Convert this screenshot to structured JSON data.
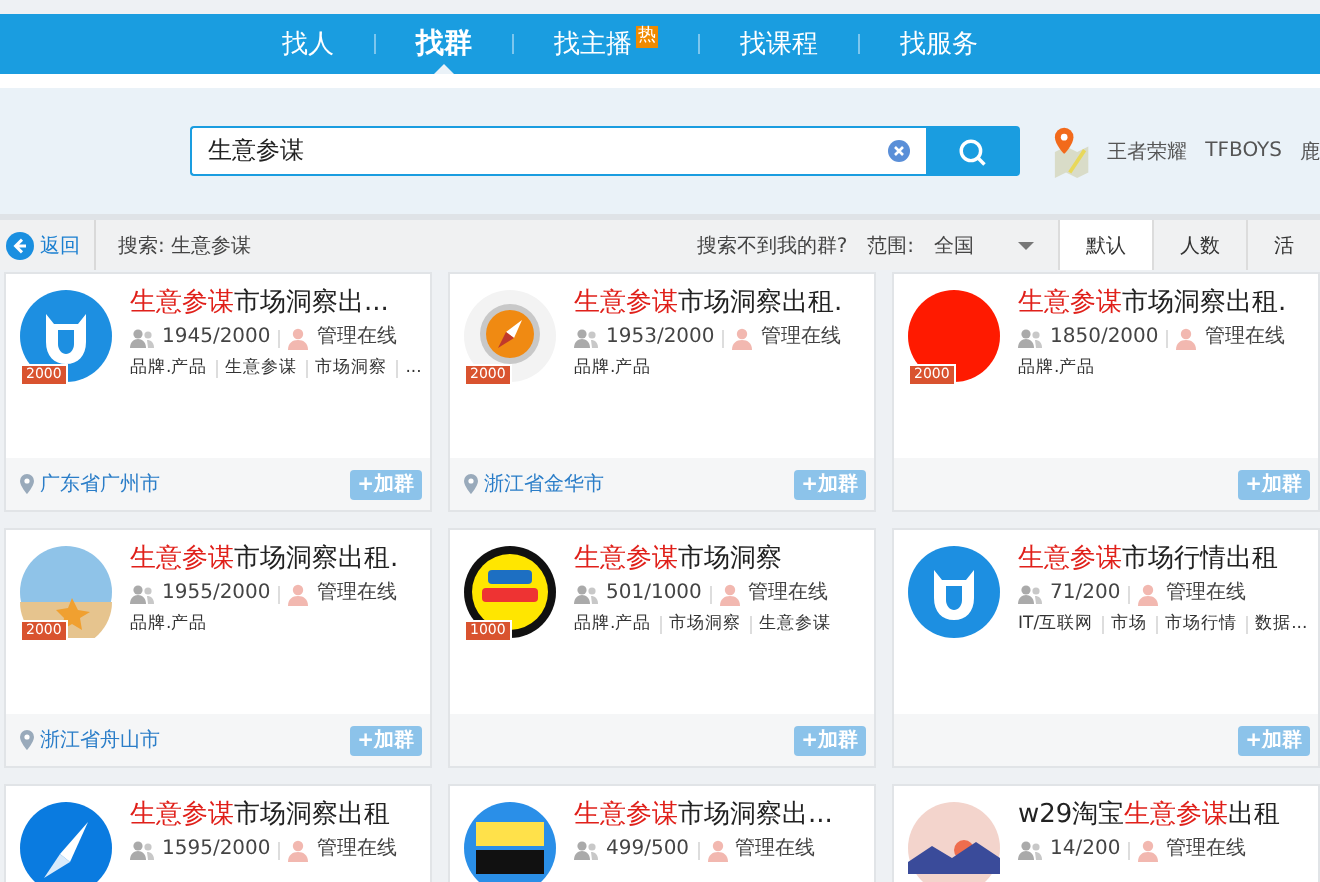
{
  "nav": {
    "tabs": [
      {
        "label": "找人",
        "selected": false
      },
      {
        "label": "找群",
        "selected": true
      },
      {
        "label": "找主播",
        "selected": false,
        "badge": "热"
      },
      {
        "label": "找课程",
        "selected": false
      },
      {
        "label": "找服务",
        "selected": false
      }
    ]
  },
  "search": {
    "value": "生意参谋",
    "hot_keywords": [
      "王者荣耀",
      "TFBOYS",
      "鹿"
    ]
  },
  "filter_bar": {
    "back": "返回",
    "query": "搜索: 生意参谋",
    "not_found_link": "搜索不到我的群?",
    "range_label": "范围:",
    "range_value": "全国",
    "sort_tabs": [
      {
        "label": "默认",
        "selected": true
      },
      {
        "label": "人数",
        "selected": false
      },
      {
        "label": "活",
        "selected": false
      }
    ]
  },
  "groups": [
    {
      "avatar": {
        "kind": "cow"
      },
      "level_badge": "2000",
      "title": [
        {
          "text": "生意参谋",
          "highlight": true
        },
        {
          "text": "市场洞察出...",
          "highlight": false
        }
      ],
      "members": "1945/2000",
      "admin_status": "管理在线",
      "tags": [
        "品牌.产品",
        "生意参谋",
        "市场洞察",
        "..."
      ],
      "location": "广东省广州市",
      "join_button": "+加群"
    },
    {
      "avatar": {
        "kind": "compass-orange"
      },
      "level_badge": "2000",
      "title": [
        {
          "text": "生意参谋",
          "highlight": true
        },
        {
          "text": "市场洞察出租.",
          "highlight": false
        }
      ],
      "members": "1953/2000",
      "admin_status": "管理在线",
      "tags": [
        "品牌.产品"
      ],
      "location": "浙江省金华市",
      "join_button": "+加群"
    },
    {
      "avatar": {
        "kind": "red"
      },
      "level_badge": "2000",
      "title": [
        {
          "text": "生意参谋",
          "highlight": true
        },
        {
          "text": "市场洞察出租.",
          "highlight": false
        }
      ],
      "members": "1850/2000",
      "admin_status": "管理在线",
      "tags": [
        "品牌.产品"
      ],
      "join_button": "+加群"
    },
    {
      "avatar": {
        "kind": "photo"
      },
      "level_badge": "2000",
      "title": [
        {
          "text": "生意参谋",
          "highlight": true
        },
        {
          "text": "市场洞察出租.",
          "highlight": false
        }
      ],
      "members": "1955/2000",
      "admin_status": "管理在线",
      "tags": [
        "品牌.产品"
      ],
      "location": "浙江省舟山市",
      "join_button": "+加群"
    },
    {
      "avatar": {
        "kind": "poster-yellow"
      },
      "level_badge": "1000",
      "title": [
        {
          "text": "生意参谋",
          "highlight": true
        },
        {
          "text": "市场洞察",
          "highlight": false
        }
      ],
      "members": "501/1000",
      "admin_status": "管理在线",
      "tags": [
        "品牌.产品",
        "市场洞察",
        "生意参谋"
      ],
      "join_button": "+加群"
    },
    {
      "avatar": {
        "kind": "cow"
      },
      "title": [
        {
          "text": "生意参谋",
          "highlight": true
        },
        {
          "text": "市场行情出租",
          "highlight": false
        }
      ],
      "members": "71/200",
      "admin_status": "管理在线",
      "tags": [
        "IT/互联网",
        "市场",
        "市场行情",
        "数据..."
      ],
      "join_button": "+加群"
    },
    {
      "avatar": {
        "kind": "compass-blue"
      },
      "title": [
        {
          "text": "生意参谋",
          "highlight": true
        },
        {
          "text": "市场洞察出租",
          "highlight": false
        }
      ],
      "members": "1595/2000",
      "admin_status": "管理在线"
    },
    {
      "avatar": {
        "kind": "poster-blue"
      },
      "title": [
        {
          "text": "生意参谋",
          "highlight": true
        },
        {
          "text": "市场洞察出...",
          "highlight": false
        }
      ],
      "members": "499/500",
      "admin_status": "管理在线"
    },
    {
      "avatar": {
        "kind": "illustration"
      },
      "title": [
        {
          "text": "w29淘宝",
          "highlight": false
        },
        {
          "text": "生意参谋",
          "highlight": true
        },
        {
          "text": "出租",
          "highlight": false
        }
      ],
      "members": "14/200",
      "admin_status": "管理在线"
    }
  ]
}
